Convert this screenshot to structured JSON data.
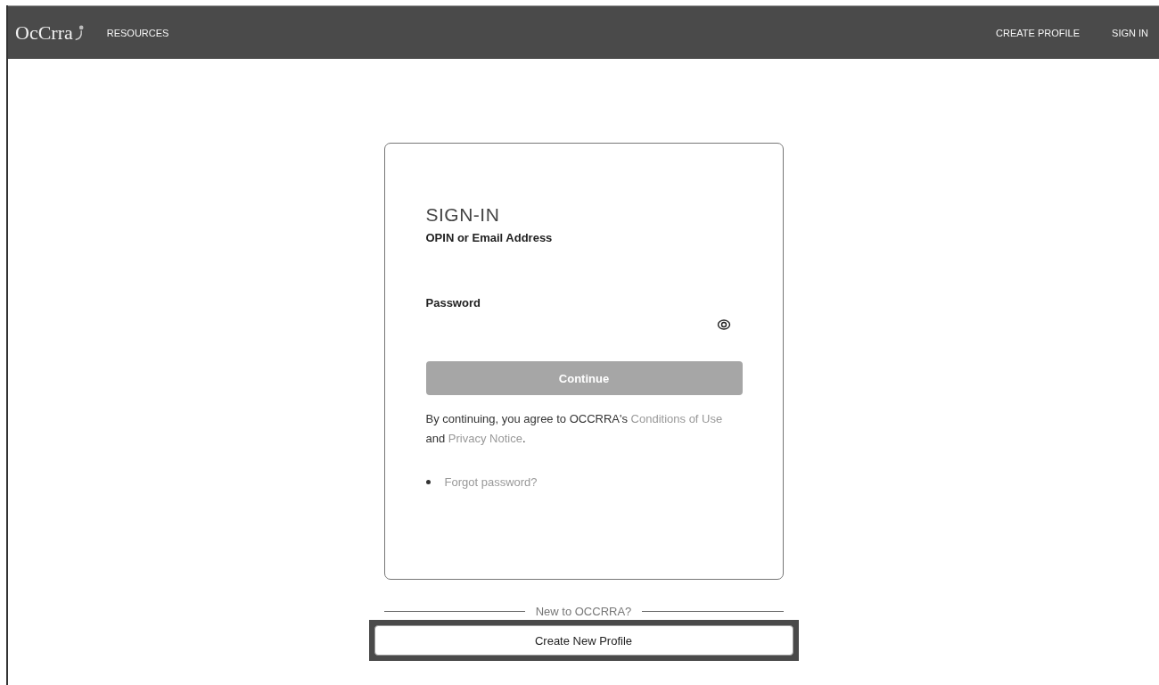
{
  "header": {
    "logo": "OcCrra",
    "nav_left": [
      {
        "label": "RESOURCES"
      }
    ],
    "nav_right": [
      {
        "label": "CREATE PROFILE"
      },
      {
        "label": "SIGN IN"
      }
    ]
  },
  "signin": {
    "title": "SIGN-IN",
    "fields": [
      {
        "label": "OPIN or Email Address",
        "kind": "text"
      },
      {
        "label": "Password",
        "kind": "password"
      }
    ],
    "continue_button": {
      "label": "Continue",
      "disabled": true
    },
    "agreement": "By continuing, you agree to OCCRRA's ",
    "agreement_links": [
      "Conditions of Use",
      "Privacy Notice"
    ],
    "agreement_join": " and ",
    "agreement_end": ".",
    "help_links": [
      "Forgot password?"
    ]
  },
  "new_user": {
    "divider_text": "New to OCCRRA?",
    "button": "Create New Profile"
  }
}
